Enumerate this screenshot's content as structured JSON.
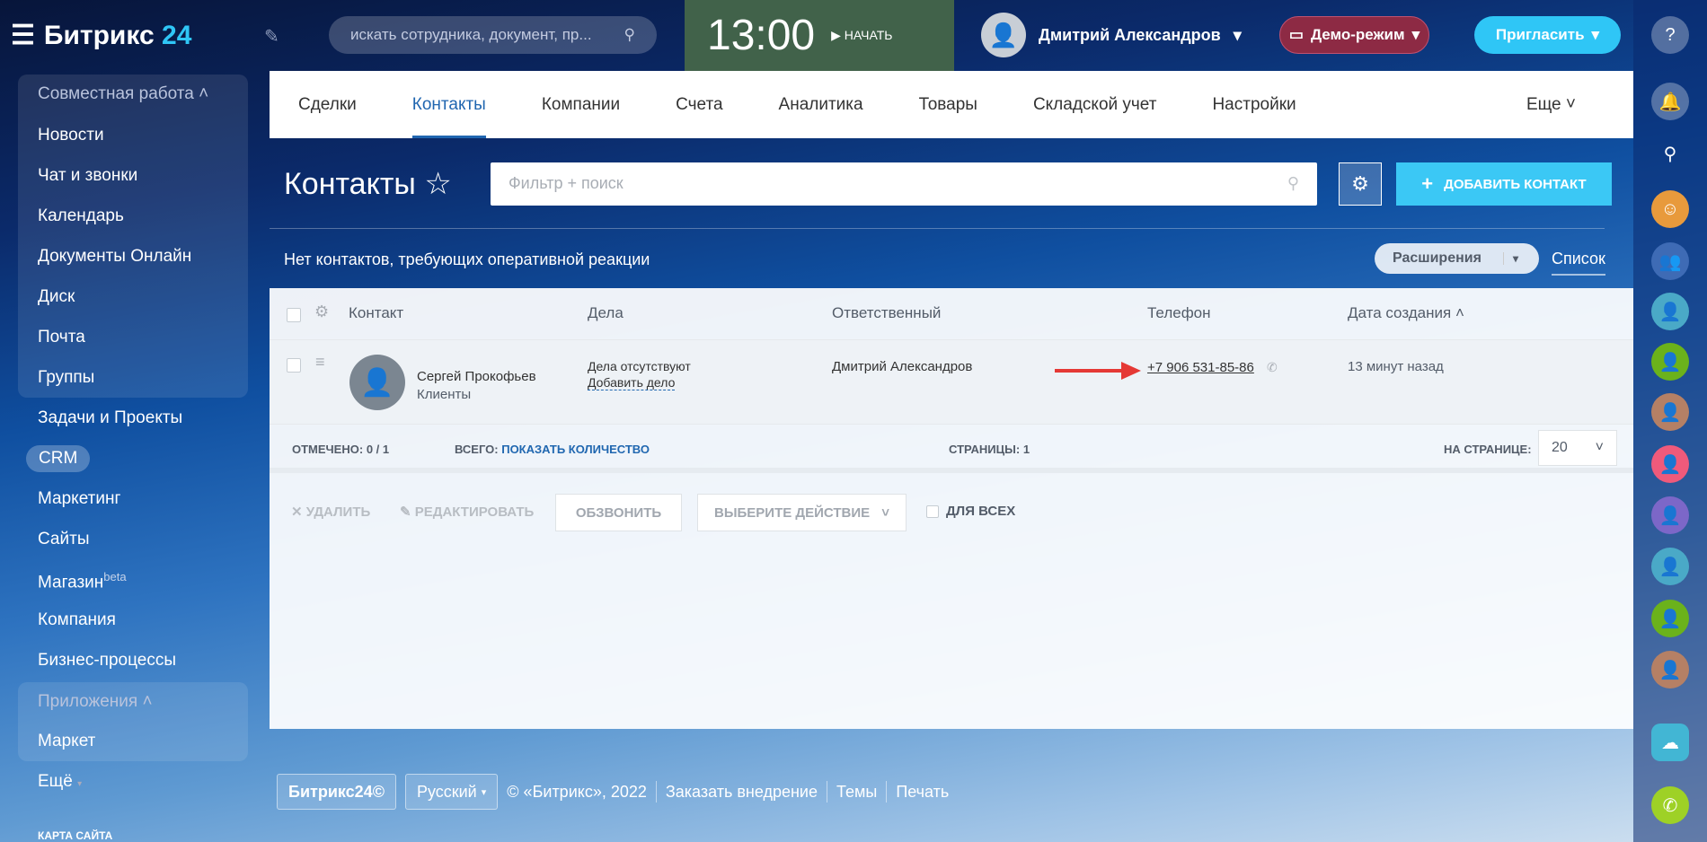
{
  "header": {
    "logo": "Битрикс",
    "logo_num": "24",
    "search_placeholder": "искать сотрудника, документ, пр...",
    "time": "13:00",
    "start": "НАЧАТЬ",
    "user": "Дмитрий Александров",
    "demo": "Демо-режим",
    "invite": "Пригласить"
  },
  "sidebar": {
    "group1": "Совместная работа",
    "items1": [
      "Новости",
      "Чат и звонки",
      "Календарь",
      "Документы Онлайн",
      "Диск",
      "Почта",
      "Группы"
    ],
    "items2": [
      "Задачи и Проекты",
      "CRM",
      "Маркетинг",
      "Сайты",
      "Магазин",
      "Компания",
      "Бизнес-процессы"
    ],
    "shop_badge": "beta",
    "group2": "Приложения",
    "market": "Маркет",
    "more": "Ещё",
    "sitemap": "КАРТА САЙТА"
  },
  "tabs": [
    "Сделки",
    "Контакты",
    "Компании",
    "Счета",
    "Аналитика",
    "Товары",
    "Складской учет",
    "Настройки"
  ],
  "tabs_more": "Еще",
  "page": {
    "title": "Контакты",
    "filter_placeholder": "Фильтр + поиск",
    "add": "ДОБАВИТЬ КОНТАКТ",
    "no_reaction": "Нет контактов, требующих оперативной реакции",
    "extensions": "Расширения",
    "list": "Список"
  },
  "grid": {
    "columns": [
      "Контакт",
      "Дела",
      "Ответственный",
      "Телефон",
      "Дата создания"
    ],
    "row": {
      "name": "Сергей Прокофьев",
      "type": "Клиенты",
      "deals": "Дела отсутствуют",
      "add_deal": "Добавить дело",
      "responsible": "Дмитрий Александров",
      "phone": "+7 906 531-85-86",
      "created": "13 минут назад"
    },
    "footer": {
      "marked_label": "ОТМЕЧЕНО:",
      "marked": "0 / 1",
      "total_label": "ВСЕГО:",
      "total_link": "ПОКАЗАТЬ КОЛИЧЕСТВО",
      "pages_label": "СТРАНИЦЫ:",
      "pages": "1",
      "per_page_label": "НА СТРАНИЦЕ:",
      "per_page": "20"
    },
    "actions": {
      "delete": "УДАЛИТЬ",
      "edit": "РЕДАКТИРОВАТЬ",
      "call": "ОБЗВОНИТЬ",
      "select": "ВЫБЕРИТЕ ДЕЙСТВИЕ",
      "for_all": "ДЛЯ ВСЕХ"
    }
  },
  "footer": {
    "brand": "Битрикс24",
    "lang": "Русский",
    "copy": "© «Битрикс», 2022",
    "order": "Заказать внедрение",
    "themes": "Темы",
    "print": "Печать"
  },
  "colors": {
    "accent": "#2fc6f6",
    "link": "#2067b0",
    "demo": "#8d2a44",
    "timeman": "#41624a",
    "arrow": "#e53935"
  }
}
